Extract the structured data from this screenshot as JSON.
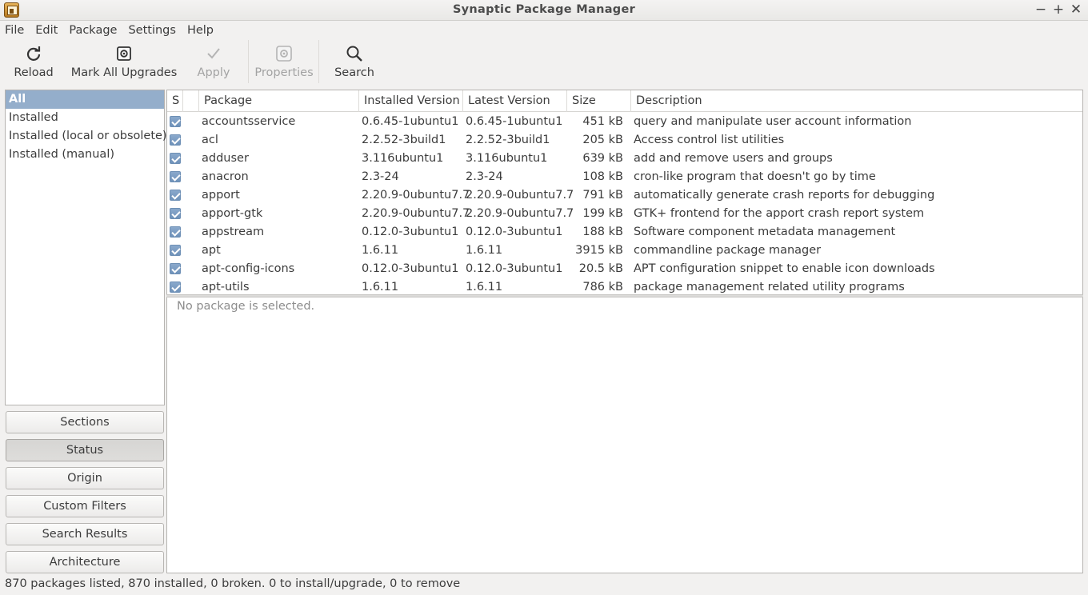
{
  "window": {
    "title": "Synaptic Package Manager"
  },
  "menu": [
    "File",
    "Edit",
    "Package",
    "Settings",
    "Help"
  ],
  "toolbar": {
    "reload": "Reload",
    "mark_all_upgrades": "Mark All Upgrades",
    "apply": "Apply",
    "properties": "Properties",
    "search": "Search"
  },
  "filters": [
    "All",
    "Installed",
    "Installed (local or obsolete)",
    "Installed (manual)"
  ],
  "selected_filter": "All",
  "sidebar_buttons": [
    "Sections",
    "Status",
    "Origin",
    "Custom Filters",
    "Search Results",
    "Architecture"
  ],
  "active_sidebar_button": "Status",
  "table": {
    "columns": [
      "S",
      "Package",
      "Installed Version",
      "Latest Version",
      "Size",
      "Description"
    ],
    "rows": [
      {
        "package": "accountsservice",
        "installed": "0.6.45-1ubuntu1",
        "latest": "0.6.45-1ubuntu1",
        "size": "451 kB",
        "description": "query and manipulate user account information"
      },
      {
        "package": "acl",
        "installed": "2.2.52-3build1",
        "latest": "2.2.52-3build1",
        "size": "205 kB",
        "description": "Access control list utilities"
      },
      {
        "package": "adduser",
        "installed": "3.116ubuntu1",
        "latest": "3.116ubuntu1",
        "size": "639 kB",
        "description": "add and remove users and groups"
      },
      {
        "package": "anacron",
        "installed": "2.3-24",
        "latest": "2.3-24",
        "size": "108 kB",
        "description": "cron-like program that doesn't go by time"
      },
      {
        "package": "apport",
        "installed": "2.20.9-0ubuntu7.7",
        "latest": "2.20.9-0ubuntu7.7",
        "size": "791 kB",
        "description": "automatically generate crash reports for debugging"
      },
      {
        "package": "apport-gtk",
        "installed": "2.20.9-0ubuntu7.7",
        "latest": "2.20.9-0ubuntu7.7",
        "size": "199 kB",
        "description": "GTK+ frontend for the apport crash report system"
      },
      {
        "package": "appstream",
        "installed": "0.12.0-3ubuntu1",
        "latest": "0.12.0-3ubuntu1",
        "size": "188 kB",
        "description": "Software component metadata management"
      },
      {
        "package": "apt",
        "installed": "1.6.11",
        "latest": "1.6.11",
        "size": "3915 kB",
        "description": "commandline package manager"
      },
      {
        "package": "apt-config-icons",
        "installed": "0.12.0-3ubuntu1",
        "latest": "0.12.0-3ubuntu1",
        "size": "20.5 kB",
        "description": "APT configuration snippet to enable icon downloads"
      },
      {
        "package": "apt-utils",
        "installed": "1.6.11",
        "latest": "1.6.11",
        "size": "786 kB",
        "description": "package management related utility programs"
      }
    ]
  },
  "description_pane": "No package is selected.",
  "status_bar": "870 packages listed, 870 installed, 0 broken. 0 to install/upgrade, 0 to remove",
  "icons": {
    "reload": "reload-icon",
    "mark_all_upgrades": "upgrade-icon",
    "apply": "checkmark-icon",
    "properties": "properties-icon",
    "search": "search-icon"
  },
  "colors": {
    "selection": "#94aecb",
    "checkbox": "#7a9bc2",
    "window_bg": "#f2f1f0"
  }
}
